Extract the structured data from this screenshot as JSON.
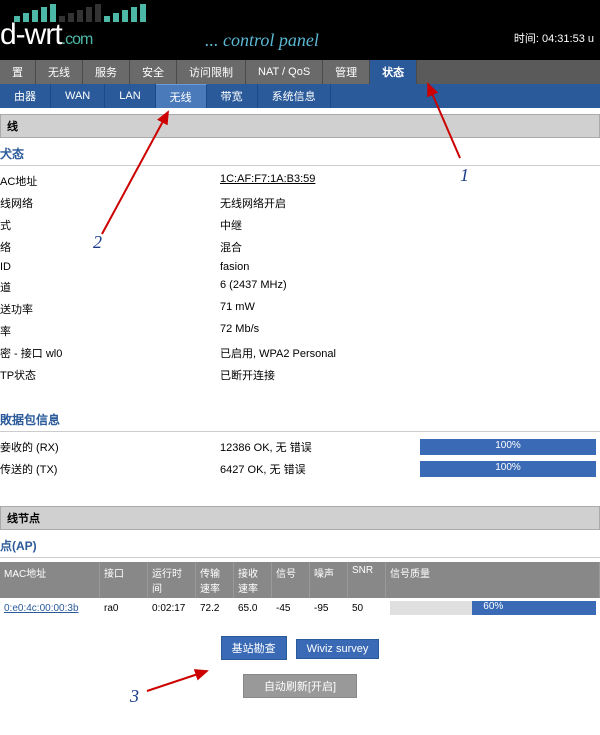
{
  "header": {
    "brand": "d-wrt",
    "domain": ".com",
    "subtitle": "... control panel",
    "time": "时间: 04:31:53 u"
  },
  "mainTabs": [
    "置",
    "无线",
    "服务",
    "安全",
    "访问限制",
    "NAT / QoS",
    "管理",
    "状态"
  ],
  "subTabs": [
    "由器",
    "WAN",
    "LAN",
    "无线",
    "带宽",
    "系统信息"
  ],
  "sectionWireless": "线",
  "status": {
    "title": "犬态",
    "mac": {
      "label": "AC地址",
      "value": "1C:AF:F7:1A:B3:59"
    },
    "network": {
      "label": "线网络",
      "value": "无线网络开启"
    },
    "mode": {
      "label": "式",
      "value": "中继"
    },
    "net": {
      "label": "络",
      "value": "混合"
    },
    "ssid": {
      "label": "ID",
      "value": "fasion"
    },
    "channel": {
      "label": "道",
      "value": "6 (2437 MHz)"
    },
    "txpower": {
      "label": "送功率",
      "value": "71 mW"
    },
    "rate": {
      "label": "率",
      "value": "72 Mb/s"
    },
    "security": {
      "label": "密 - 接口 wl0",
      "value": "已启用, WPA2 Personal"
    },
    "tpstatus": {
      "label": "TP状态",
      "value": "已断开连接"
    }
  },
  "packets": {
    "title": "敗据包信息",
    "rx": {
      "label": "妾收的 (RX)",
      "value": "12386 OK, 无 错误",
      "percent": "100%"
    },
    "tx": {
      "label": "传送的 (TX)",
      "value": "6427 OK, 无 错误",
      "percent": "100%"
    }
  },
  "nodesTitle": "线节点",
  "apSection": {
    "title": "点(AP)",
    "headers": [
      "MAC地址",
      "接口",
      "运行时间",
      "传输速率",
      "接收速率",
      "信号",
      "噪声",
      "SNR",
      "信号质量"
    ],
    "row": {
      "mac": "0:e0:4c:00:00:3b",
      "iface": "ra0",
      "uptime": "0:02:17",
      "txrate": "72.2",
      "rxrate": "65.0",
      "signal": "-45",
      "noise": "-95",
      "snr": "50",
      "quality": "60%"
    }
  },
  "buttons": {
    "survey": "基站勘查",
    "wiviz": "Wiviz survey",
    "refresh": "自动刷新[开启]"
  },
  "annotations": {
    "a1": "1",
    "a2": "2",
    "a3": "3"
  }
}
